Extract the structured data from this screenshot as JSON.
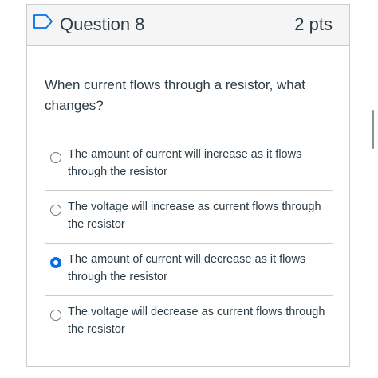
{
  "question": {
    "title": "Question 8",
    "points": "2 pts",
    "text": "When current flows through a resistor, what changes?"
  },
  "answers": [
    {
      "text": "The amount of current will increase as it flows through the resistor",
      "selected": false
    },
    {
      "text": "The voltage will increase as current flows through the resistor",
      "selected": false
    },
    {
      "text": "The amount of current will decrease as it flows through the resistor",
      "selected": true
    },
    {
      "text": "The voltage will decrease as current flows through the resistor",
      "selected": false
    }
  ],
  "colors": {
    "accent": "#0770e3",
    "border": "#c7cdd1",
    "text": "#2d3b45"
  },
  "icons": {
    "flag": "bookmark-flag-icon"
  }
}
